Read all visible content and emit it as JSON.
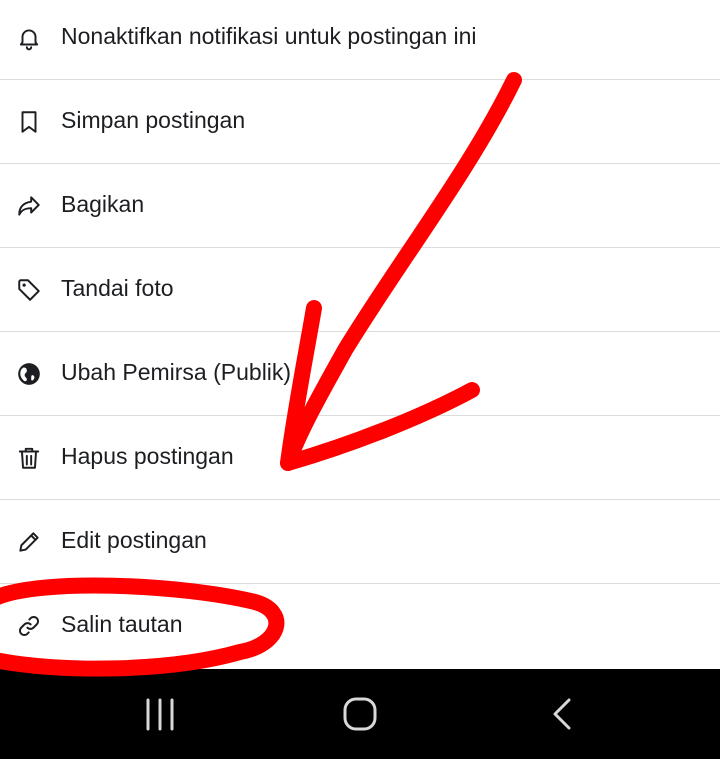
{
  "menu": {
    "items": [
      {
        "label": "Nonaktifkan notifikasi untuk postingan ini",
        "icon": "bell-icon"
      },
      {
        "label": "Simpan postingan",
        "icon": "bookmark-icon"
      },
      {
        "label": "Bagikan",
        "icon": "share-icon"
      },
      {
        "label": "Tandai foto",
        "icon": "tag-icon"
      },
      {
        "label": "Ubah Pemirsa (Publik)",
        "icon": "globe-icon"
      },
      {
        "label": "Hapus postingan",
        "icon": "trash-icon"
      },
      {
        "label": "Edit postingan",
        "icon": "pencil-icon"
      },
      {
        "label": "Salin tautan",
        "icon": "link-icon"
      }
    ]
  },
  "navbar": {
    "buttons": [
      "recent-apps",
      "home",
      "back"
    ]
  },
  "annotation": {
    "color": "#ff0000",
    "arrow_target": "Hapus postingan",
    "circled_item": "Salin tautan"
  }
}
